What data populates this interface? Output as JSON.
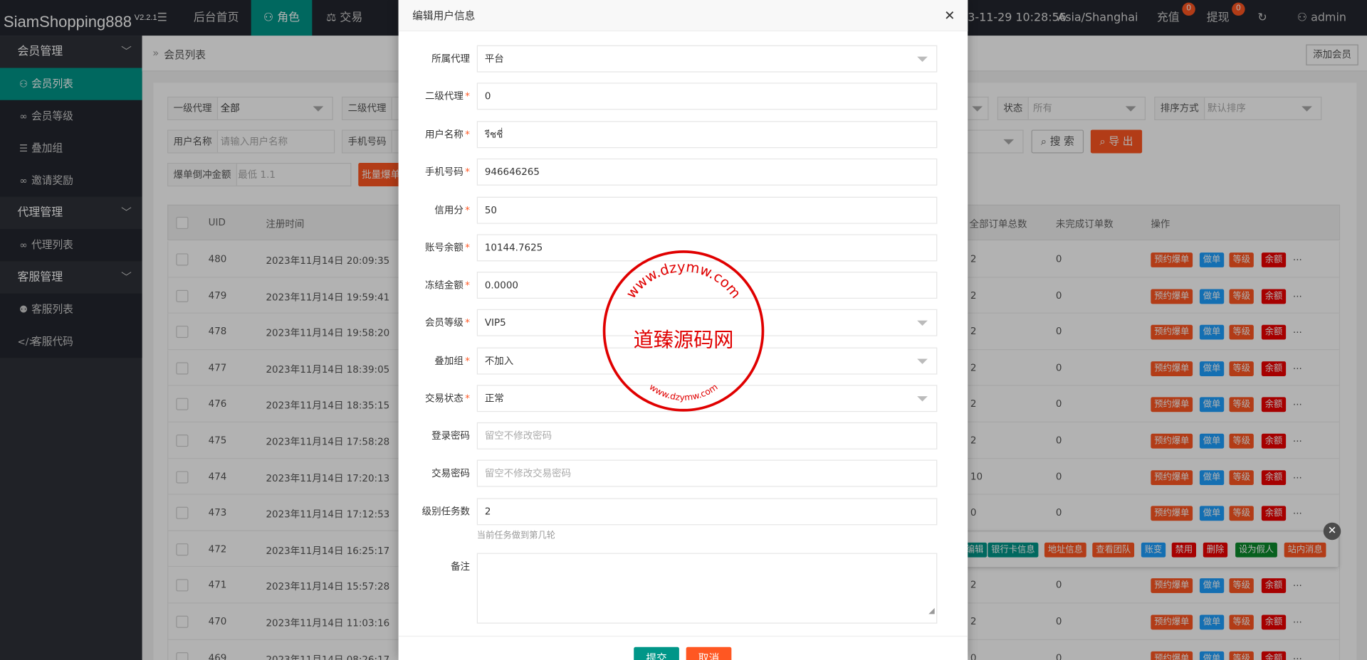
{
  "app": {
    "name": "SiamShopping888",
    "version": "V2.2.1"
  },
  "topnav": {
    "home": "后台首页",
    "role": "角色",
    "trade": "交易",
    "datetime": "3-11-29 10:28:56",
    "timezone": "Asia/Shanghai",
    "recharge": "充值",
    "recharge_badge": "0",
    "withdraw": "提现",
    "withdraw_badge": "0",
    "user": "admin"
  },
  "sidebar": {
    "group_member": "会员管理",
    "item_member_list": "会员列表",
    "item_member_level": "会员等级",
    "item_overlay_group": "叠加组",
    "item_invite_reward": "邀请奖励",
    "group_agent": "代理管理",
    "item_agent_list": "代理列表",
    "group_service": "客服管理",
    "item_service_list": "客服列表",
    "item_service_code": "客服代码"
  },
  "breadcrumb": {
    "current": "会员列表",
    "add_member": "添加会员"
  },
  "filters": {
    "level1_agent_label": "一级代理",
    "level1_agent_value": "全部",
    "level2_agent_label": "二级代理",
    "status_label": "状态",
    "status_value": "所有",
    "sort_label": "排序方式",
    "sort_value": "默认排序",
    "username_label": "用户名称",
    "username_placeholder": "请输入用户名称",
    "phone_label": "手机号码",
    "search_button": "搜 索",
    "export_button": "导 出",
    "burst_label": "爆单倒冲金额",
    "burst_placeholder": "最低 1.1",
    "batch_button": "批量爆单"
  },
  "table": {
    "headers": {
      "uid": "UID",
      "register_time": "注册时间",
      "total_orders": "全部订单总数",
      "unfinished_orders": "未完成订单数",
      "actions": "操作"
    },
    "rows": [
      {
        "uid": "480",
        "time": "2023年11月14日 20:09:35",
        "total": "2",
        "unfinished": "0"
      },
      {
        "uid": "479",
        "time": "2023年11月14日 19:59:41",
        "total": "2",
        "unfinished": "0"
      },
      {
        "uid": "478",
        "time": "2023年11月14日 19:58:20",
        "total": "2",
        "unfinished": "0"
      },
      {
        "uid": "477",
        "time": "2023年11月14日 18:39:05",
        "total": "2",
        "unfinished": "0"
      },
      {
        "uid": "476",
        "time": "2023年11月14日 18:35:15",
        "total": "2",
        "unfinished": "0"
      },
      {
        "uid": "475",
        "time": "2023年11月14日 17:58:28",
        "total": "2",
        "unfinished": "0"
      },
      {
        "uid": "474",
        "time": "2023年11月14日 17:20:13",
        "total": "10",
        "unfinished": "0"
      },
      {
        "uid": "473",
        "time": "2023年11月14日 17:12:53",
        "total": "0",
        "unfinished": "0"
      },
      {
        "uid": "472",
        "time": "2023年11月14日 16:25:17",
        "total": "",
        "unfinished": ""
      },
      {
        "uid": "471",
        "time": "2023年11月14日 15:57:28",
        "total": "2",
        "unfinished": "0"
      },
      {
        "uid": "470",
        "time": "2023年11月14日 11:03:16",
        "total": "2",
        "unfinished": "0"
      },
      {
        "uid": "469",
        "time": "2023年11月14日 08:26:17",
        "total": "0",
        "unfinished": "0"
      }
    ],
    "row_actions": {
      "reserve": "预约爆单",
      "order": "做单",
      "level": "等级",
      "balance": "余额",
      "more": "..."
    },
    "popup_actions": {
      "edit": "编辑",
      "bank": "银行卡信息",
      "address": "地址信息",
      "team": "查看团队",
      "ledger": "账变",
      "disable": "禁用",
      "delete": "删除",
      "fake": "设为假人",
      "message": "站内消息"
    }
  },
  "modal": {
    "title": "编辑用户信息",
    "fields": {
      "agent_label": "所属代理",
      "agent_value": "平台",
      "sub_agent_label": "二级代理",
      "sub_agent_value": "0",
      "username_label": "用户名称",
      "username_value": "รีชชี่",
      "phone_label": "手机号码",
      "phone_value": "946646265",
      "credit_label": "信用分",
      "credit_value": "50",
      "balance_label": "账号余额",
      "balance_value": "10144.7625",
      "frozen_label": "冻结金额",
      "frozen_value": "0.0000",
      "level_label": "会员等级",
      "level_value": "VIP5",
      "group_label": "叠加组",
      "group_value": "不加入",
      "trade_status_label": "交易状态",
      "trade_status_value": "正常",
      "login_pw_label": "登录密码",
      "login_pw_placeholder": "留空不修改密码",
      "trade_pw_label": "交易密码",
      "trade_pw_placeholder": "留空不修改交易密码",
      "task_label": "级别任务数",
      "task_value": "2",
      "task_hint": "当前任务做到第几轮",
      "remark_label": "备注"
    },
    "submit": "提交",
    "cancel": "取消"
  },
  "watermark": {
    "center": "道臻源码网",
    "ring_top": "www.dzymw.com",
    "ring_bottom": "www.dzymw.com"
  },
  "colors": {
    "accent": "#009688",
    "danger": "#ff5722",
    "stamp": "#e00000"
  }
}
